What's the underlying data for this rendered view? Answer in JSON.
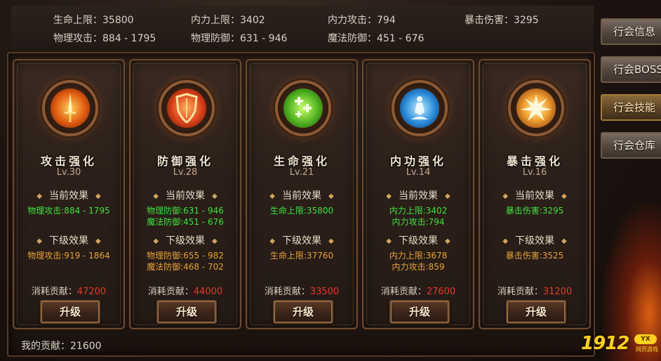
{
  "stats": [
    {
      "text": "生命上限：35800"
    },
    {
      "text": "内力上限：3402"
    },
    {
      "text": "内力攻击：794"
    },
    {
      "text": "暴击伤害：3295"
    },
    {
      "text": "物理攻击：884 - 1795"
    },
    {
      "text": "物理防御：631 - 946"
    },
    {
      "text": "魔法防御：451 - 676"
    }
  ],
  "labels": {
    "current": "当前效果",
    "next": "下级效果",
    "cost": "消耗贡献：",
    "upgrade": "升级",
    "my_contribution": "我的贡献：21600"
  },
  "cards": [
    {
      "title": "攻击强化",
      "level": "Lv.30",
      "cur": [
        "物理攻击:884 - 1795"
      ],
      "next": [
        "物理攻击:919 - 1864"
      ],
      "cost": "47200",
      "icon": "sword-icon"
    },
    {
      "title": "防御强化",
      "level": "Lv.28",
      "cur": [
        "物理防御:631 - 946",
        "魔法防御:451 - 676"
      ],
      "next": [
        "物理防御:655 - 982",
        "魔法防御:468 - 702"
      ],
      "cost": "44000",
      "icon": "shield-icon"
    },
    {
      "title": "生命强化",
      "level": "Lv.21",
      "cur": [
        "生命上限:35800"
      ],
      "next": [
        "生命上限:37760"
      ],
      "cost": "33500",
      "icon": "health-crosses-icon"
    },
    {
      "title": "内功强化",
      "level": "Lv.14",
      "cur": [
        "内力上限:3402",
        "内力攻击:794"
      ],
      "next": [
        "内力上限:3678",
        "内力攻击:859"
      ],
      "cost": "27600",
      "icon": "meditation-icon"
    },
    {
      "title": "暴击强化",
      "level": "Lv.16",
      "cur": [
        "暴击伤害:3295"
      ],
      "next": [
        "暴击伤害:3525"
      ],
      "cost": "31200",
      "icon": "explosion-icon"
    }
  ],
  "tabs": [
    {
      "label": "行会信息",
      "active": false
    },
    {
      "label": "行会BOSS",
      "active": false
    },
    {
      "label": "行会技能",
      "active": true
    },
    {
      "label": "行会仓库",
      "active": false
    }
  ],
  "watermark": {
    "number": "1912",
    "badge": "YX",
    "sub": "网页游戏"
  }
}
